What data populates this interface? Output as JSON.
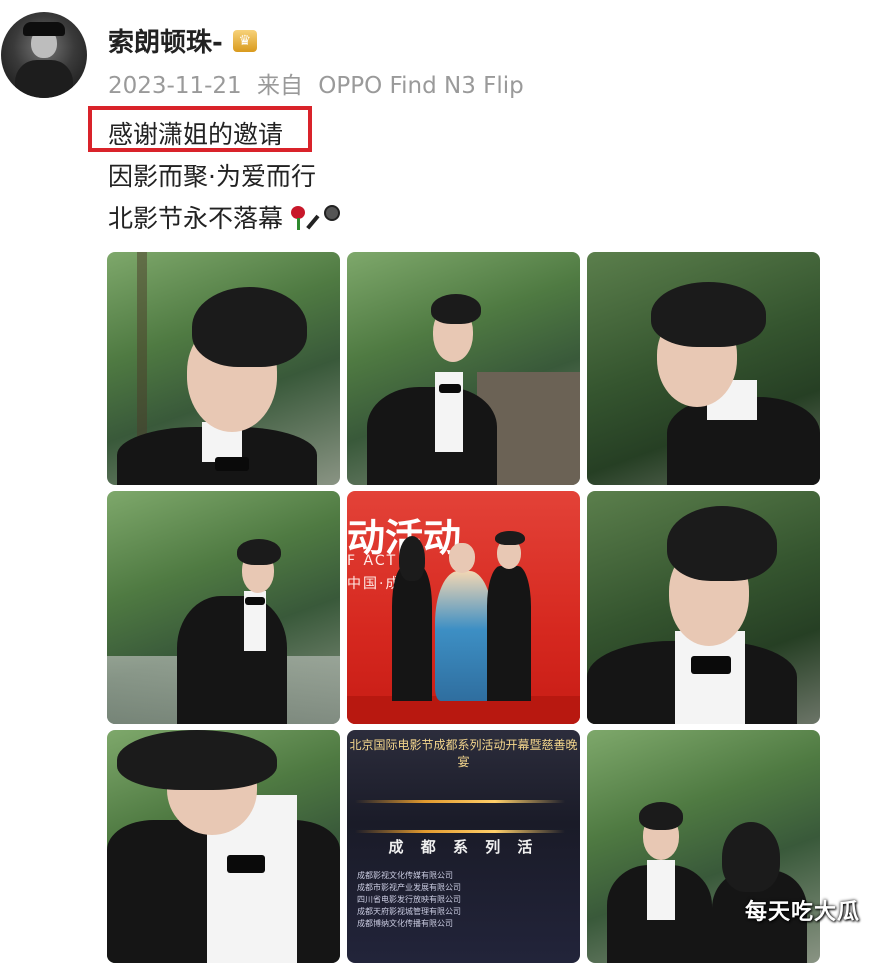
{
  "profile": {
    "username": "索朗顿珠-",
    "badge_icon": "vip-crown-icon",
    "date": "2023-11-21",
    "source_prefix": "来自",
    "device": "OPPO Find N3 Flip"
  },
  "post": {
    "line1": "感谢潇姐的邀请",
    "line2": "因影而聚·为爱而行",
    "line3": "北影节永不落幕",
    "emojis": [
      "rose-icon",
      "microphone-icon"
    ],
    "highlight_color": "#d9232a"
  },
  "photos": {
    "photo5": {
      "title": "动活动",
      "sub": "F ACT",
      "extra": "中国·成"
    },
    "photo8": {
      "header": "北京国际电影节成都系列活动开幕暨慈善晚宴",
      "mid_text": "成 都 系 列 活",
      "list": [
        "成都影视文化传媒有限公司",
        "成都市影视产业发展有限公司",
        "四川省电影发行放映有限公司",
        "成都天府影视城管理有限公司",
        "成都博纳文化传播有限公司"
      ]
    }
  },
  "watermark": "每天吃大瓜"
}
